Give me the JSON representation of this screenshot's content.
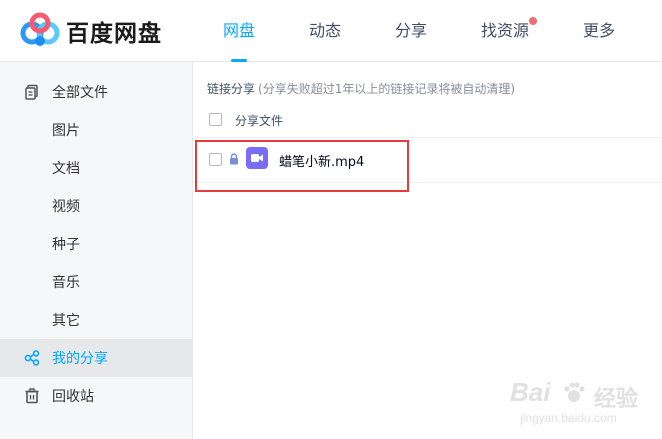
{
  "app": {
    "name": "百度网盘"
  },
  "nav": {
    "items": [
      {
        "label": "网盘",
        "active": true
      },
      {
        "label": "动态",
        "active": false
      },
      {
        "label": "分享",
        "active": false
      },
      {
        "label": "找资源",
        "active": false,
        "badge_dot": true
      },
      {
        "label": "更多",
        "active": false
      }
    ]
  },
  "sidebar": {
    "items": [
      {
        "label": "全部文件",
        "icon": "all-files-icon"
      },
      {
        "label": "图片"
      },
      {
        "label": "文档"
      },
      {
        "label": "视频"
      },
      {
        "label": "种子"
      },
      {
        "label": "音乐"
      },
      {
        "label": "其它"
      },
      {
        "label": "我的分享",
        "icon": "share-icon",
        "active": true
      },
      {
        "label": "回收站",
        "icon": "trash-icon"
      }
    ]
  },
  "content": {
    "section_title": "链接分享",
    "section_note": "(分享失败超过1年以上的链接记录将被自动清理)",
    "column_header": "分享文件",
    "files": [
      {
        "name": "蜡笔小新.mp4",
        "type": "video",
        "locked": true
      }
    ]
  },
  "watermark": {
    "brand": "Bai",
    "brand_cn": "经验",
    "url": "jingyan.baidu.com"
  },
  "colors": {
    "accent": "#06a7ff",
    "highlight_border": "#e63b3b",
    "video_icon": "#7b6cf6",
    "lock": "#7a8fd6",
    "badge_dot": "#f56c6c"
  }
}
